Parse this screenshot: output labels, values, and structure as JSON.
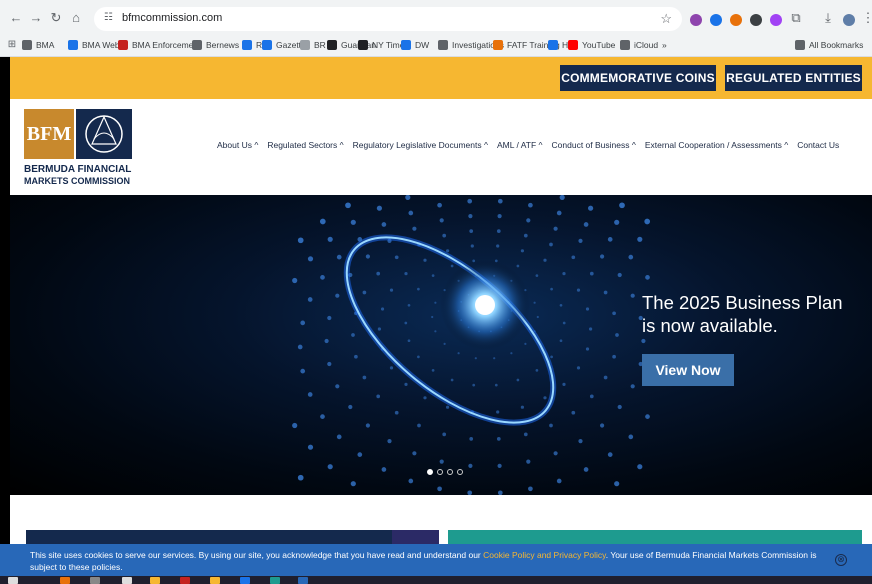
{
  "browser": {
    "url": "bfmcommission.com",
    "bookmarks": [
      "BMA",
      "BMA Web",
      "BMA Enforcement",
      "Bernews",
      "RG",
      "Gazette",
      "BR",
      "Guardian",
      "NY Times",
      "DW",
      "Investigations",
      "FATF Training",
      "HM",
      "YouTube",
      "iCloud",
      "»",
      "All Bookmarks"
    ],
    "bookmark_colors": [
      "#5f6368",
      "#1a73e8",
      "#c5221f",
      "#5f6368",
      "#1a73e8",
      "#1a73e8",
      "#9aa0a6",
      "#202124",
      "#202124",
      "#1a73e8",
      "#5f6368",
      "#e8710a",
      "#1a73e8",
      "#ff0000",
      "#5f6368",
      "#5f6368",
      "#5f6368"
    ]
  },
  "site": {
    "top_buttons": [
      "COMMEMORATIVE COINS",
      "REGULATED ENTITIES"
    ],
    "logo": {
      "mark": "BFM",
      "line1": "BERMUDA FINANCIAL",
      "line2": "MARKETS COMMISSION"
    },
    "menu": [
      "About Us ^",
      "Regulated Sectors ^",
      "Regulatory Legislative Documents ^",
      "AML / ATF ^",
      "Conduct of Business ^",
      "External Cooperation / Assessments ^",
      "Contact Us"
    ],
    "hero": {
      "title_line1": "The 2025 Business Plan",
      "title_line2": "is now available.",
      "button": "View Now",
      "slides_total": 4,
      "slide_active": 1
    },
    "cookie": {
      "text_before": "This site uses cookies to serve our services. By using our site, you acknowledge that you have read and understand our ",
      "link": "Cookie Policy and Privacy Policy",
      "text_after": ". Your use of Bermuda Financial Markets Commission is subject to these policies.",
      "close": "⊗"
    }
  },
  "colors": {
    "topbar": "#f6b731",
    "navy": "#14294d",
    "hero_button": "#3a6fa8",
    "cookie_bg": "#2868b8",
    "teal": "#1e9b8f"
  }
}
